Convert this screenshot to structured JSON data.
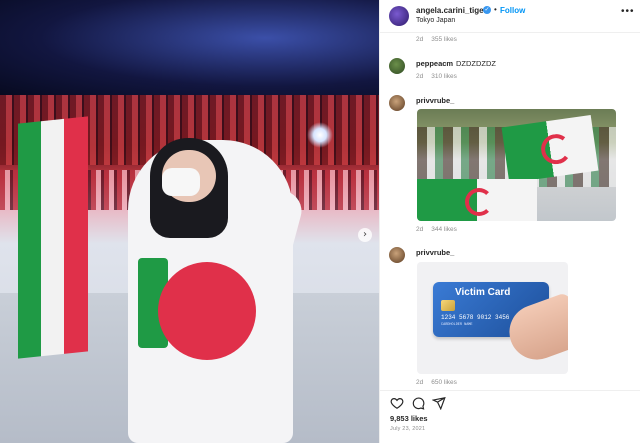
{
  "post": {
    "username": "angela.carini_tiger",
    "follow_label": "Follow",
    "location": "Tokyo Japan",
    "separator": "•",
    "more_icon": "more-horizontal-icon"
  },
  "comments": [
    {
      "meta_time": "2d",
      "meta_likes": "355 likes"
    },
    {
      "username": "peppeacm",
      "text": "DZDZDZDZ",
      "meta_time": "2d",
      "meta_likes": "310 likes"
    },
    {
      "username": "privvrube_",
      "image": "algeria-fans-photo",
      "meta_time": "2d",
      "meta_likes": "344 likes"
    },
    {
      "username": "privvrube_",
      "image": "credit-card-meme",
      "card_title": "Victim Card",
      "card_number": "1234 5678 9012 3456",
      "card_holder": "CARDHOLDER NAME",
      "meta_time": "2d",
      "meta_likes": "650 likes"
    }
  ],
  "actions": {
    "icons": [
      "heart-icon",
      "comment-icon",
      "share-icon"
    ],
    "likes": "9,853 likes",
    "date": "July 23, 2021"
  },
  "colors": {
    "accent": "#0095f6",
    "verified": "#3897f0",
    "text": "#262626",
    "muted": "#8e8e8e"
  }
}
